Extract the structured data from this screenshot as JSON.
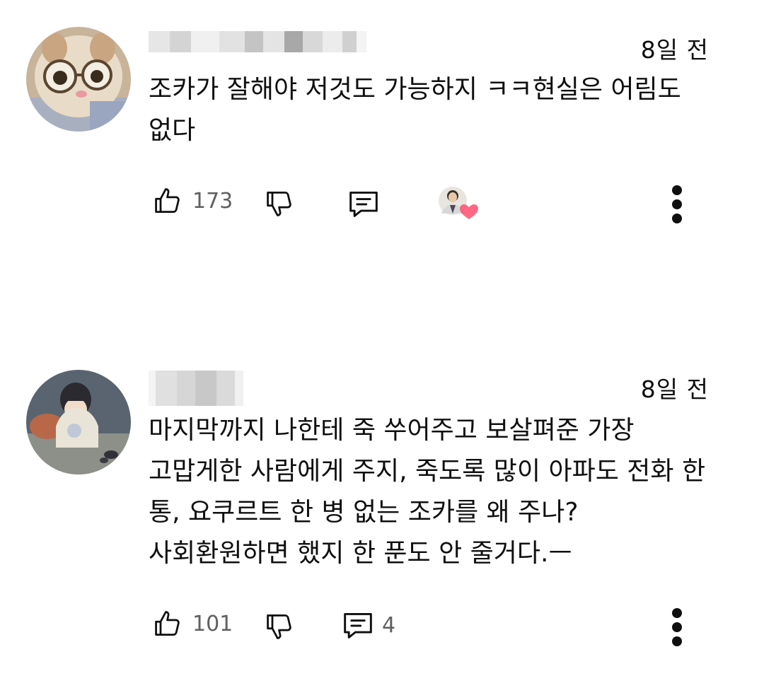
{
  "comments": [
    {
      "timestamp": "8일 전",
      "text": "조카가 잘해야 저것도 가능하지 ㅋㅋ현실은 어림도 없다",
      "likes": "173",
      "replies": "",
      "creator_heart": true
    },
    {
      "timestamp": "8일 전",
      "text": "마지막까지 나한테 죽 쑤어주고 보살펴준 가장 고맙게한 사람에게 주지, 죽도록 많이 아파도 전화 한 통, 요쿠르트 한 병 없는 조카를 왜 주나? 사회환원하면 했지 한 푼도 안 줄거다.ㅡ",
      "likes": "101",
      "replies": "4",
      "creator_heart": false
    }
  ],
  "icons": {
    "like": "thumb-up-icon",
    "dislike": "thumb-down-icon",
    "reply": "comment-icon",
    "menu": "more-vert-icon",
    "heart": "creator-heart-icon"
  },
  "colors": {
    "text": "#0f0f0f",
    "secondary": "#606060",
    "heart": "#ff4e6e"
  }
}
